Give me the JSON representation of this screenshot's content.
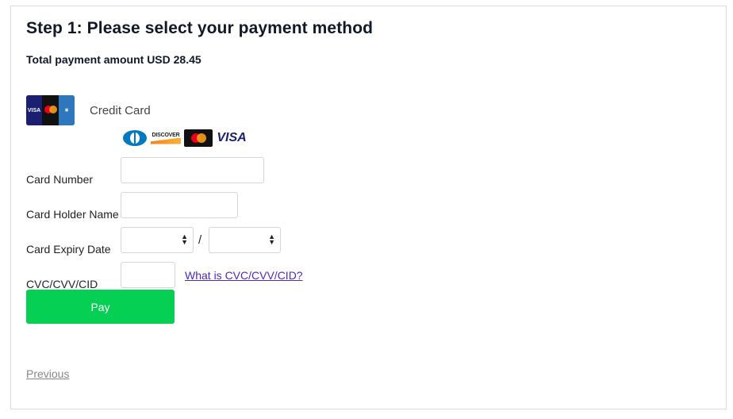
{
  "header": {
    "title": "Step 1: Please select your payment method",
    "amount_text": "Total payment amount USD 28.45"
  },
  "payment_method": {
    "label": "Credit Card",
    "logo_icon": "credit-cards-logo-icon",
    "logo_text_visa": "VISA",
    "accepted_brands": [
      {
        "name": "diners-club",
        "icon": "diners-club-icon"
      },
      {
        "name": "discover",
        "icon": "discover-icon",
        "text": "DISCOVER"
      },
      {
        "name": "mastercard",
        "icon": "mastercard-icon"
      },
      {
        "name": "visa",
        "icon": "visa-icon",
        "text": "VISA"
      }
    ]
  },
  "form": {
    "card_number_label": "Card Number",
    "card_number_value": "",
    "card_holder_label": "Card Holder Name",
    "card_holder_value": "",
    "expiry_label": "Card Expiry Date",
    "expiry_month_value": "",
    "expiry_year_value": "",
    "expiry_separator": "/",
    "cvc_label": "CVC/CVV/CID",
    "cvc_value": "",
    "cvc_help_link": "What is CVC/CVV/CID?"
  },
  "actions": {
    "pay_label": "Pay",
    "previous_label": "Previous"
  },
  "colors": {
    "pay_button": "#06d054",
    "link": "#4b2bb8",
    "title": "#111827"
  }
}
